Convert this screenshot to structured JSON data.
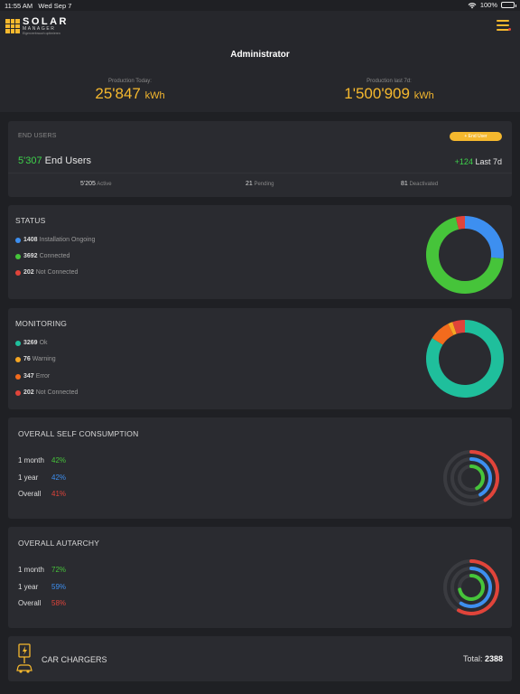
{
  "status_bar": {
    "time": "11:55 AM",
    "date": "Wed Sep 7",
    "battery": "100%",
    "wifi_icon": "wifi-icon"
  },
  "brand": {
    "name": "SOLAR",
    "subname": "MANAGER",
    "tagline": "Eigenverbrauch optimieren",
    "color": "#f5b82e"
  },
  "header": {
    "title": "Administrator",
    "production_today": {
      "label": "Production Today:",
      "value": "25'847",
      "unit": "kWh"
    },
    "production_7d": {
      "label": "Production last 7d:",
      "value": "1'500'909",
      "unit": "kWh"
    }
  },
  "end_users": {
    "title": "END USERS",
    "add_button": "+ End User",
    "count": "5'307",
    "count_label": "End Users",
    "delta": "+124",
    "delta_label": "Last 7d",
    "stats": [
      {
        "value": "5'205",
        "label": "Active"
      },
      {
        "value": "21",
        "label": "Pending"
      },
      {
        "value": "81",
        "label": "Deactivated"
      }
    ]
  },
  "status": {
    "title": "STATUS",
    "items": [
      {
        "value": "1408",
        "label": "Installation Ongoing",
        "color": "#3d8ff0"
      },
      {
        "value": "3692",
        "label": "Connected",
        "color": "#46c43a"
      },
      {
        "value": "202",
        "label": "Not Connected",
        "color": "#e0443a"
      }
    ]
  },
  "monitoring": {
    "title": "MONITORING",
    "items": [
      {
        "value": "3269",
        "label": "Ok",
        "color": "#1fbf9c"
      },
      {
        "value": "76",
        "label": "Warning",
        "color": "#f5a623"
      },
      {
        "value": "347",
        "label": "Error",
        "color": "#f26b1d"
      },
      {
        "value": "202",
        "label": "Not Connected",
        "color": "#e0443a"
      }
    ]
  },
  "self_consumption": {
    "title": "OVERALL SELF CONSUMPTION",
    "rows": [
      {
        "label": "1 month",
        "value": "42%",
        "pct": 42,
        "color": "#46c43a"
      },
      {
        "label": "1 year",
        "value": "42%",
        "pct": 42,
        "color": "#3d8ff0"
      },
      {
        "label": "Overall",
        "value": "41%",
        "pct": 41,
        "color": "#e0443a"
      }
    ]
  },
  "autarchy": {
    "title": "OVERALL AUTARCHY",
    "rows": [
      {
        "label": "1 month",
        "value": "72%",
        "pct": 72,
        "color": "#46c43a"
      },
      {
        "label": "1 year",
        "value": "59%",
        "pct": 59,
        "color": "#3d8ff0"
      },
      {
        "label": "Overall",
        "value": "58%",
        "pct": 58,
        "color": "#e0443a"
      }
    ]
  },
  "car_chargers": {
    "title": "CAR CHARGERS",
    "total_label": "Total:",
    "total": "2388",
    "icon": "ev-charger-icon"
  }
}
